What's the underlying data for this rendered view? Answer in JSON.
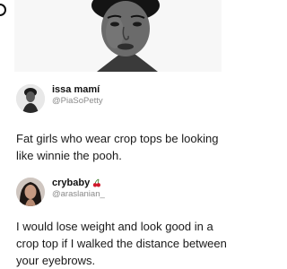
{
  "tweet1": {
    "display_name": "issa mamí",
    "handle": "@PiaSoPetty",
    "text": "Fat girls who wear crop tops be looking like winnie the pooh."
  },
  "tweet2": {
    "display_name": "crybaby",
    "handle": "@araslanian_",
    "text": "I would lose weight and look good in a crop top if I walked the distance between your eyebrows.",
    "name_emoji": "cherry-icon"
  },
  "colors": {
    "background": "#ffffff",
    "text": "#1a1a1a",
    "handle": "#8a8a8a",
    "cherry": "#d0192b"
  }
}
